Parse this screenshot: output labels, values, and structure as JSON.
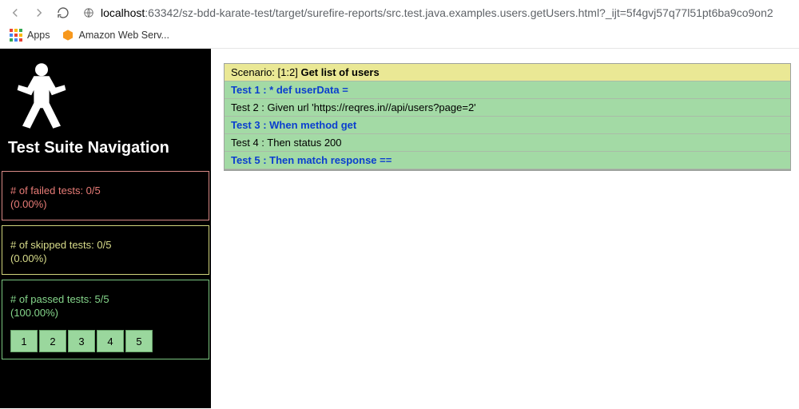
{
  "browser": {
    "url_host": "localhost",
    "url_port": ":63342",
    "url_path": "/sz-bdd-karate-test/target/surefire-reports/src.test.java.examples.users.getUsers.html?_ijt=5f4gvj57q77l51pt6ba9co9on2",
    "apps_label": "Apps",
    "bookmark1": "Amazon Web Serv..."
  },
  "sidebar": {
    "title": "Test Suite Navigation",
    "failed_line1": "# of failed tests: 0/5",
    "failed_line2": "(0.00%)",
    "skipped_line1": "# of skipped tests: 0/5",
    "skipped_line2": "(0.00%)",
    "passed_line1": "# of passed tests: 5/5",
    "passed_line2": "(100.00%)",
    "tests": [
      "1",
      "2",
      "3",
      "4",
      "5"
    ]
  },
  "report": {
    "scenario_prefix": "Scenario: [1:2] ",
    "scenario_title": "Get list of users",
    "rows": [
      {
        "text": "Test 1 : * def userData =",
        "link": true
      },
      {
        "text": "Test 2 : Given url 'https://reqres.in//api/users?page=2'",
        "link": false
      },
      {
        "text": "Test 3 : When method get",
        "link": true
      },
      {
        "text": "Test 4 : Then status 200",
        "link": false
      },
      {
        "text": "Test 5 : Then match response ==",
        "link": true
      }
    ]
  }
}
